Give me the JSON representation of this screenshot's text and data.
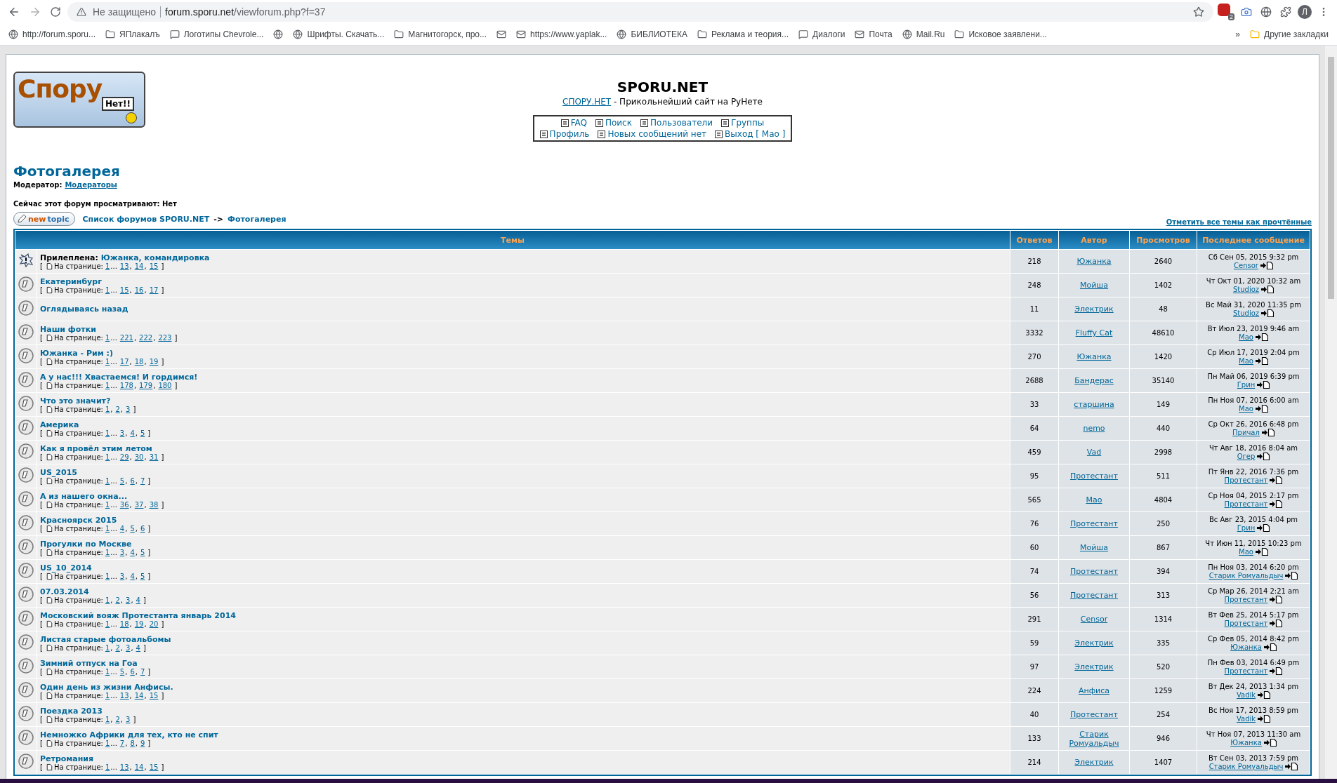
{
  "browser": {
    "security": "Не защищено",
    "host": "forum.sporu.net",
    "path": "/viewforum.php?f=37",
    "extension_badge": "2",
    "profile": "Л",
    "bookmarks": [
      {
        "kind": "link",
        "label": "http://forum.sporu..."
      },
      {
        "kind": "link",
        "label": "ЯПлакалъ"
      },
      {
        "kind": "link",
        "label": "Логотипы Chevrole..."
      },
      {
        "kind": "icon"
      },
      {
        "kind": "link",
        "label": "Шрифты. Скачать..."
      },
      {
        "kind": "link",
        "label": "Магнитогорск, про..."
      },
      {
        "kind": "icon"
      },
      {
        "kind": "link",
        "label": "https://www.yaplak..."
      },
      {
        "kind": "link",
        "label": "БИБЛИОТЕКА"
      },
      {
        "kind": "link",
        "label": "Реклама и теория..."
      },
      {
        "kind": "link",
        "label": "Диалоги"
      },
      {
        "kind": "link",
        "label": "Почта"
      },
      {
        "kind": "link",
        "label": "Mail.Ru"
      },
      {
        "kind": "link",
        "label": "Исковое заявлени..."
      }
    ],
    "bookmarks_more": "»",
    "other_bookmarks": "Другие закладки"
  },
  "logo": {
    "word": "Спору",
    "sign": "Нет!!"
  },
  "site": {
    "title": "SPORU.NET",
    "home_link": "СПОРУ.НЕТ",
    "tagline": " - Прикольнейший сайт на РуНете",
    "nav": [
      [
        {
          "label": "FAQ"
        },
        {
          "label": "Поиск"
        },
        {
          "label": "Пользователи"
        },
        {
          "label": "Группы"
        }
      ],
      [
        {
          "label": "Профиль"
        },
        {
          "label": "Новых сообщений нет"
        },
        {
          "label": "Выход [ Мао ]"
        }
      ]
    ]
  },
  "forum": {
    "title": "Фотогалерея",
    "moderator_label": "Модератор:",
    "moderator_link": "Модераторы",
    "viewing": "Сейчас этот форум просматривают: Нет",
    "new_topic": [
      "new",
      "topic"
    ],
    "breadcrumb": [
      "Список форумов SPORU.NET",
      "->",
      "Фотогалерея"
    ],
    "mark_read": "Отметить все темы как прочтённые"
  },
  "table": {
    "columns": [
      "Темы",
      "Ответов",
      "Автор",
      "Просмотров",
      "Последнее сообщение"
    ],
    "rows": [
      {
        "kind": "sticky",
        "prefix": "Прилеплена:",
        "title": "Южанка, командировка",
        "pages_open": "[",
        "pages_label": "На странице:",
        "pages": [
          {
            "label": "1",
            "after": "..."
          },
          {
            "label": "13",
            "after": ","
          },
          {
            "label": "14",
            "after": ","
          },
          {
            "label": "15"
          }
        ],
        "pages_close": "]",
        "replies": "218",
        "author": "Южанка",
        "views": "2640",
        "last_date": "Сб Сен 05, 2015 9:32 pm",
        "last_user": "Censor"
      },
      {
        "kind": "normal",
        "title": "Екатеринбург",
        "pages_open": "[",
        "pages_label": "На странице:",
        "pages": [
          {
            "label": "1",
            "after": "..."
          },
          {
            "label": "15",
            "after": ","
          },
          {
            "label": "16",
            "after": ","
          },
          {
            "label": "17"
          }
        ],
        "pages_close": "]",
        "replies": "248",
        "author": "Мойша",
        "views": "1402",
        "last_date": "Чт Окт 01, 2020 10:32 am",
        "last_user": "Studioz"
      },
      {
        "kind": "normal",
        "title": "Оглядываясь назад",
        "replies": "11",
        "author": "Электрик",
        "views": "48",
        "last_date": "Вс Май 31, 2020 11:35 pm",
        "last_user": "Studioz"
      },
      {
        "kind": "normal",
        "title": "Наши фотки",
        "pages_open": "[",
        "pages_label": "На странице:",
        "pages": [
          {
            "label": "1",
            "after": "..."
          },
          {
            "label": "221",
            "after": ","
          },
          {
            "label": "222",
            "after": ","
          },
          {
            "label": "223"
          }
        ],
        "pages_close": "]",
        "replies": "3332",
        "author": "Fluffy Cat",
        "views": "48610",
        "last_date": "Вт Июл 23, 2019 9:46 am",
        "last_user": "Мао"
      },
      {
        "kind": "normal",
        "title": "Южанка - Рим :)",
        "pages_open": "[",
        "pages_label": "На странице:",
        "pages": [
          {
            "label": "1",
            "after": "..."
          },
          {
            "label": "17",
            "after": ","
          },
          {
            "label": "18",
            "after": ","
          },
          {
            "label": "19"
          }
        ],
        "pages_close": "]",
        "replies": "270",
        "author": "Южанка",
        "views": "1420",
        "last_date": "Ср Июл 17, 2019 2:04 pm",
        "last_user": "Мао"
      },
      {
        "kind": "normal",
        "title": "А у нас!!! Хвастаемся! И гордимся!",
        "pages_open": "[",
        "pages_label": "На странице:",
        "pages": [
          {
            "label": "1",
            "after": "..."
          },
          {
            "label": "178",
            "after": ","
          },
          {
            "label": "179",
            "after": ","
          },
          {
            "label": "180"
          }
        ],
        "pages_close": "]",
        "replies": "2688",
        "author": "Бандерас",
        "views": "35140",
        "last_date": "Пн Май 06, 2019 6:39 pm",
        "last_user": "Грин"
      },
      {
        "kind": "normal",
        "title": "Что это значит?",
        "pages_open": "[",
        "pages_label": "На странице:",
        "pages": [
          {
            "label": "1",
            "after": ","
          },
          {
            "label": "2",
            "after": ","
          },
          {
            "label": "3"
          }
        ],
        "pages_close": "]",
        "replies": "33",
        "author": "старшина",
        "views": "149",
        "last_date": "Пн Ноя 07, 2016 6:00 am",
        "last_user": "Мао"
      },
      {
        "kind": "normal",
        "title": "Америка",
        "pages_open": "[",
        "pages_label": "На странице:",
        "pages": [
          {
            "label": "1",
            "after": "..."
          },
          {
            "label": "3",
            "after": ","
          },
          {
            "label": "4",
            "after": ","
          },
          {
            "label": "5"
          }
        ],
        "pages_close": "]",
        "replies": "64",
        "author": "nemo",
        "views": "440",
        "last_date": "Ср Окт 26, 2016 6:48 pm",
        "last_user": "Причал"
      },
      {
        "kind": "normal",
        "title": "Как я провёл этим летом",
        "pages_open": "[",
        "pages_label": "На странице:",
        "pages": [
          {
            "label": "1",
            "after": "..."
          },
          {
            "label": "29",
            "after": ","
          },
          {
            "label": "30",
            "after": ","
          },
          {
            "label": "31"
          }
        ],
        "pages_close": "]",
        "replies": "459",
        "author": "Vad",
        "views": "2998",
        "last_date": "Чт Авг 18, 2016 8:04 am",
        "last_user": "Огер"
      },
      {
        "kind": "normal",
        "title": "US_2015",
        "pages_open": "[",
        "pages_label": "На странице:",
        "pages": [
          {
            "label": "1",
            "after": "..."
          },
          {
            "label": "5",
            "after": ","
          },
          {
            "label": "6",
            "after": ","
          },
          {
            "label": "7"
          }
        ],
        "pages_close": "]",
        "replies": "95",
        "author": "Протестант",
        "views": "511",
        "last_date": "Пт Янв 22, 2016 7:36 pm",
        "last_user": "Протестант"
      },
      {
        "kind": "normal",
        "title": "А из нашего окна...",
        "pages_open": "[",
        "pages_label": "На странице:",
        "pages": [
          {
            "label": "1",
            "after": "..."
          },
          {
            "label": "36",
            "after": ","
          },
          {
            "label": "37",
            "after": ","
          },
          {
            "label": "38"
          }
        ],
        "pages_close": "]",
        "replies": "565",
        "author": "Мао",
        "views": "4804",
        "last_date": "Ср Ноя 04, 2015 2:17 pm",
        "last_user": "Протестант"
      },
      {
        "kind": "normal",
        "title": "Красноярск 2015",
        "pages_open": "[",
        "pages_label": "На странице:",
        "pages": [
          {
            "label": "1",
            "after": "..."
          },
          {
            "label": "4",
            "after": ","
          },
          {
            "label": "5",
            "after": ","
          },
          {
            "label": "6"
          }
        ],
        "pages_close": "]",
        "replies": "76",
        "author": "Протестант",
        "views": "250",
        "last_date": "Вс Авг 23, 2015 4:04 pm",
        "last_user": "Грин"
      },
      {
        "kind": "normal",
        "title": "Прогулки по Москве",
        "pages_open": "[",
        "pages_label": "На странице:",
        "pages": [
          {
            "label": "1",
            "after": "..."
          },
          {
            "label": "3",
            "after": ","
          },
          {
            "label": "4",
            "after": ","
          },
          {
            "label": "5"
          }
        ],
        "pages_close": "]",
        "replies": "60",
        "author": "Мойша",
        "views": "867",
        "last_date": "Чт Июн 11, 2015 10:23 pm",
        "last_user": "Мао"
      },
      {
        "kind": "normal",
        "title": "US_10_2014",
        "pages_open": "[",
        "pages_label": "На странице:",
        "pages": [
          {
            "label": "1",
            "after": "..."
          },
          {
            "label": "3",
            "after": ","
          },
          {
            "label": "4",
            "after": ","
          },
          {
            "label": "5"
          }
        ],
        "pages_close": "]",
        "replies": "74",
        "author": "Протестант",
        "views": "394",
        "last_date": "Пн Ноя 03, 2014 6:20 pm",
        "last_user": "Старик Ромуальдыч"
      },
      {
        "kind": "normal",
        "title": "07.03.2014",
        "pages_open": "[",
        "pages_label": "На странице:",
        "pages": [
          {
            "label": "1",
            "after": ","
          },
          {
            "label": "2",
            "after": ","
          },
          {
            "label": "3",
            "after": ","
          },
          {
            "label": "4"
          }
        ],
        "pages_close": "]",
        "replies": "56",
        "author": "Протестант",
        "views": "313",
        "last_date": "Ср Мар 26, 2014 2:21 am",
        "last_user": "Протестант"
      },
      {
        "kind": "normal",
        "title": "Московский вояж Протестанта январь 2014",
        "pages_open": "[",
        "pages_label": "На странице:",
        "pages": [
          {
            "label": "1",
            "after": "..."
          },
          {
            "label": "18",
            "after": ","
          },
          {
            "label": "19",
            "after": ","
          },
          {
            "label": "20"
          }
        ],
        "pages_close": "]",
        "replies": "291",
        "author": "Censor",
        "views": "1314",
        "last_date": "Вт Фев 25, 2014 5:17 pm",
        "last_user": "Протестант"
      },
      {
        "kind": "normal",
        "title": "Листая старые фотоальбомы",
        "pages_open": "[",
        "pages_label": "На странице:",
        "pages": [
          {
            "label": "1",
            "after": ","
          },
          {
            "label": "2",
            "after": ","
          },
          {
            "label": "3",
            "after": ","
          },
          {
            "label": "4"
          }
        ],
        "pages_close": "]",
        "replies": "59",
        "author": "Электрик",
        "views": "335",
        "last_date": "Ср Фев 05, 2014 8:42 pm",
        "last_user": "Южанка"
      },
      {
        "kind": "normal",
        "title": "Зимний отпуск на Гоа",
        "pages_open": "[",
        "pages_label": "На странице:",
        "pages": [
          {
            "label": "1",
            "after": "..."
          },
          {
            "label": "5",
            "after": ","
          },
          {
            "label": "6",
            "after": ","
          },
          {
            "label": "7"
          }
        ],
        "pages_close": "]",
        "replies": "97",
        "author": "Электрик",
        "views": "520",
        "last_date": "Пн Фев 03, 2014 6:49 pm",
        "last_user": "Протестант"
      },
      {
        "kind": "normal",
        "title": "Один день из жизни Анфисы.",
        "pages_open": "[",
        "pages_label": "На странице:",
        "pages": [
          {
            "label": "1",
            "after": "..."
          },
          {
            "label": "13",
            "after": ","
          },
          {
            "label": "14",
            "after": ","
          },
          {
            "label": "15"
          }
        ],
        "pages_close": "]",
        "replies": "224",
        "author": "Анфиса",
        "views": "1259",
        "last_date": "Вт Дек 24, 2013 1:34 pm",
        "last_user": "Vadik"
      },
      {
        "kind": "normal",
        "title": "Поездка 2013",
        "pages_open": "[",
        "pages_label": "На странице:",
        "pages": [
          {
            "label": "1",
            "after": ","
          },
          {
            "label": "2",
            "after": ","
          },
          {
            "label": "3"
          }
        ],
        "pages_close": "]",
        "replies": "40",
        "author": "Протестант",
        "views": "254",
        "last_date": "Вс Ноя 17, 2013 8:59 pm",
        "last_user": "Vadik"
      },
      {
        "kind": "normal",
        "title": "Немножко Африки для тех, кто не спит",
        "pages_open": "[",
        "pages_label": "На странице:",
        "pages": [
          {
            "label": "1",
            "after": "..."
          },
          {
            "label": "7",
            "after": ","
          },
          {
            "label": "8",
            "after": ","
          },
          {
            "label": "9"
          }
        ],
        "pages_close": "]",
        "replies": "133",
        "author": "Старик Ромуальдыч",
        "views": "946",
        "last_date": "Чт Ноя 07, 2013 11:30 am",
        "last_user": "Южанка"
      },
      {
        "kind": "normal",
        "title": "Ретромания",
        "pages_open": "[",
        "pages_label": "На странице:",
        "pages": [
          {
            "label": "1",
            "after": "..."
          },
          {
            "label": "13",
            "after": ","
          },
          {
            "label": "14",
            "after": ","
          },
          {
            "label": "15"
          }
        ],
        "pages_close": "]",
        "replies": "214",
        "author": "Электрик",
        "views": "1407",
        "last_date": "Вт Сен 03, 2013 7:59 pm",
        "last_user": "Старик Ромуальдыч"
      }
    ]
  }
}
